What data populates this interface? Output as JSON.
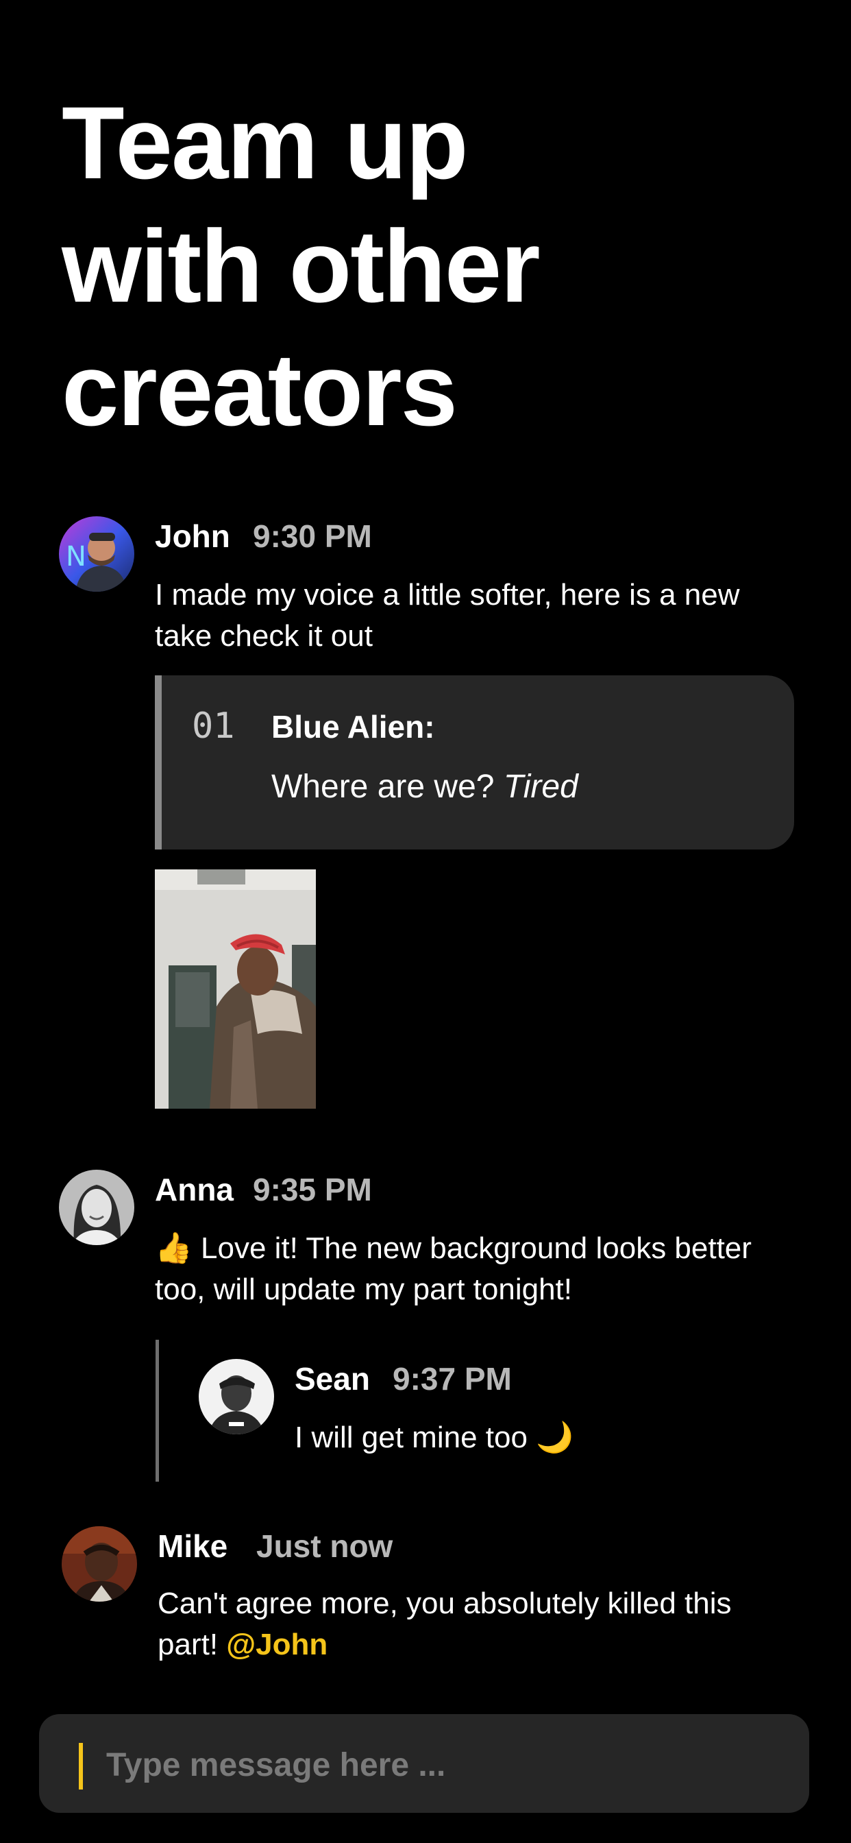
{
  "headline": {
    "line1": "Team up",
    "line2": "with other",
    "line3": "creators"
  },
  "messages": [
    {
      "author": "John",
      "time": "9:30 PM",
      "text": "I made my voice a little softer, here is a new take check it out",
      "script_quote": {
        "number": "01",
        "character": "Blue Alien:",
        "line": "Where are we?",
        "direction": "Tired"
      }
    },
    {
      "author": "Anna",
      "time": "9:35 PM",
      "emoji": "👍",
      "text": "Love it! The new background looks better too, will update my part tonight!",
      "reply": {
        "author": "Sean",
        "time": "9:37 PM",
        "text": "I will get mine too",
        "emoji": "🌙"
      }
    },
    {
      "author": "Mike",
      "time": "Just now",
      "text": "Can't agree more, you absolutely killed this part!",
      "mention": "@John"
    }
  ],
  "composer": {
    "placeholder": "Type message here ..."
  },
  "colors": {
    "background": "#000000",
    "card": "#262626",
    "accent": "#f5c41a",
    "muted_text": "#b8b8b8"
  }
}
